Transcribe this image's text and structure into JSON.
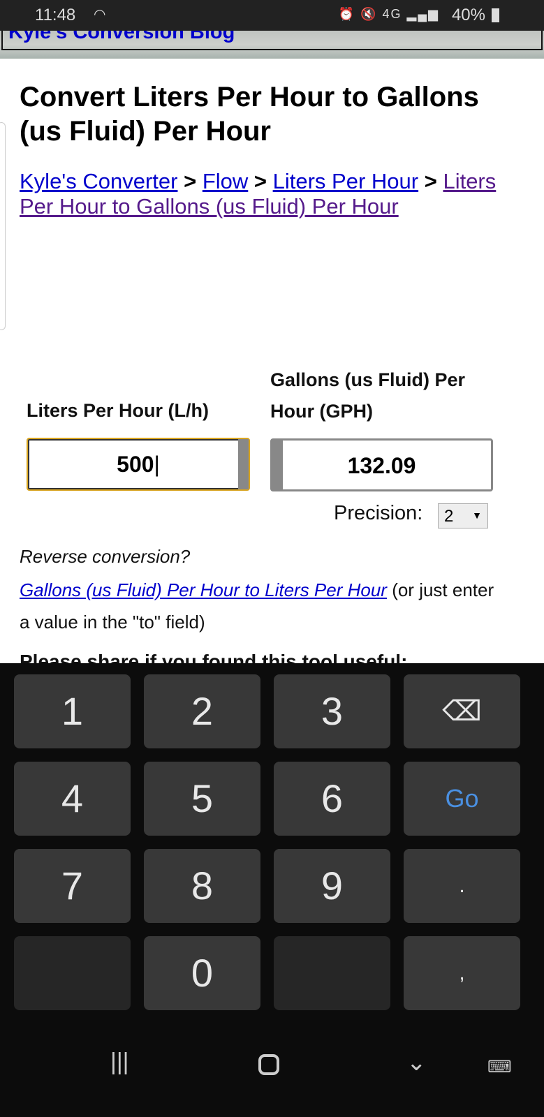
{
  "status": {
    "time": "11:48",
    "battery": "40%",
    "icons": [
      "wifi-icon",
      "alarm-icon",
      "mute-icon",
      "4g-lte-icon",
      "signal-icon",
      "battery-icon"
    ]
  },
  "banner": {
    "title": "Kyle's Conversion Blog"
  },
  "page": {
    "title": "Convert Liters Per Hour to Gallons (us Fluid) Per Hour",
    "breadcrumb": [
      {
        "label": "Kyle's Converter"
      },
      {
        "label": "Flow"
      },
      {
        "label": "Liters Per Hour"
      },
      {
        "label": "Liters Per Hour to Gallons (us Fluid) Per Hour"
      }
    ],
    "separator": ">"
  },
  "converter": {
    "from_label": "Liters Per Hour (L/h)",
    "to_label": "Gallons (us Fluid) Per Hour (GPH)",
    "from_value": "500",
    "to_value": "132.09",
    "precision_label": "Precision:",
    "precision_value": "2"
  },
  "reverse": {
    "question": "Reverse conversion?",
    "link": "Gallons (us Fluid) Per Hour to Liters Per Hour",
    "note": " (or just enter a value in the \"to\" field)"
  },
  "share": {
    "heading": "Please share if you found this tool useful:"
  },
  "keyboard": {
    "keys": [
      "1",
      "2",
      "3",
      "⌫",
      "4",
      "5",
      "6",
      "Go",
      "7",
      "8",
      "9",
      ".",
      "",
      "0",
      "",
      ","
    ],
    "go_color": "#4a90e2"
  }
}
